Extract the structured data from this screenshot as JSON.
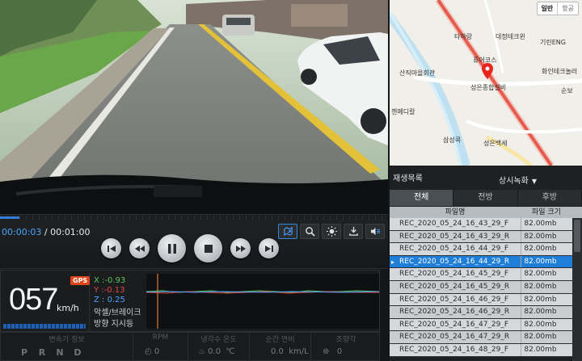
{
  "player": {
    "time_current": "00:00:03",
    "time_separator": " / ",
    "time_total": "00:01:00",
    "progress_fraction": 0.05
  },
  "toolbar": {
    "icons": [
      "map-export-icon",
      "zoom-icon",
      "brightness-icon",
      "download-icon",
      "volume-icon"
    ]
  },
  "playback": {
    "buttons": [
      "previous-file",
      "rewind",
      "pause",
      "stop",
      "fast-forward",
      "next-file"
    ]
  },
  "sensor": {
    "gps_badge": "GPS",
    "speed_value": "057",
    "speed_unit": "km/h",
    "x_value": "X :-0.93",
    "y_value": "Y :-0.13",
    "z_value": "Z : 0.25",
    "brake_label": "악셀/브레이크",
    "turn_label": "방향 지시등",
    "colors": {
      "x": "#5ac25a",
      "y": "#e04848",
      "z": "#4aa0ff",
      "marker": "#e07a30"
    }
  },
  "status_strip": {
    "gear_header": "변속기 정보",
    "gears": [
      "P",
      "R",
      "N",
      "D"
    ],
    "rpm_header": "RPM",
    "rpm_value": "0",
    "coolant_header": "냉각수 온도",
    "coolant_value": "0.0",
    "coolant_unit": "℃",
    "fuel_header": "순간 연비",
    "fuel_value": "0.0",
    "fuel_unit": "km/L",
    "steer_header": "조향각",
    "steer_value": "0"
  },
  "map": {
    "toggle_normal": "일반",
    "toggle_air": "항공",
    "labels": [
      "타하랑",
      "대정테크윈",
      "기린ENG",
      "퓨어코스",
      "산직마을회관",
      "화인테크놀러",
      "성은종합설비",
      "순보",
      "첸메디칼",
      "삼성콕",
      "성은백세"
    ]
  },
  "playlist": {
    "title": "재생목록",
    "folder": "상시녹화",
    "tabs": [
      "전체",
      "전방",
      "후방"
    ],
    "active_tab": 0,
    "col_name": "파일명",
    "col_size": "파일 크기",
    "selected_index": 3,
    "selected_mark": "▸",
    "files": [
      {
        "name": "REC_2020_05_24_16_43_29_F",
        "size": "82.00mb"
      },
      {
        "name": "REC_2020_05_24_16_43_29_R",
        "size": "82.00mb"
      },
      {
        "name": "REC_2020_05_24_16_44_29_F",
        "size": "82.00mb"
      },
      {
        "name": "REC_2020_05_24_16_44_29_R",
        "size": "82.00mb"
      },
      {
        "name": "REC_2020_05_24_16_45_29_F",
        "size": "82.00mb"
      },
      {
        "name": "REC_2020_05_24_16_45_29_R",
        "size": "82.00mb"
      },
      {
        "name": "REC_2020_05_24_16_46_29_F",
        "size": "82.00mb"
      },
      {
        "name": "REC_2020_05_24_16_46_29_R",
        "size": "82.00mb"
      },
      {
        "name": "REC_2020_05_24_16_47_29_F",
        "size": "82.00mb"
      },
      {
        "name": "REC_2020_05_24_16_47_29_R",
        "size": "82.00mb"
      },
      {
        "name": "REC_2020_05_24_16_48_29_F",
        "size": "82.00mb"
      }
    ]
  }
}
